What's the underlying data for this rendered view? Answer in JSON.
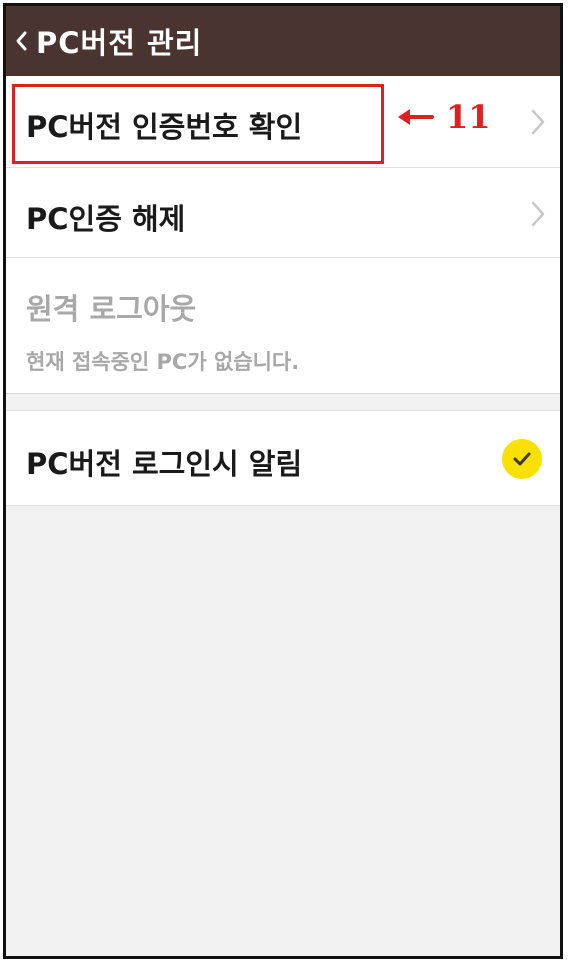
{
  "header": {
    "title": "PC버전 관리"
  },
  "menu": {
    "items": [
      {
        "label": "PC버전 인증번호 확인"
      },
      {
        "label": "PC인증 해제"
      },
      {
        "label": "원격 로그아웃",
        "sub": "현재 접속중인 PC가 없습니다."
      },
      {
        "label": "PC버전 로그인시 알림",
        "checked": true
      }
    ]
  },
  "annotation": {
    "number": "11",
    "color": "#e02020"
  },
  "colors": {
    "header_bg": "#4a3430",
    "toggle_on": "#f9e000",
    "disabled_text": "#a8a8a8"
  },
  "icons": {
    "back": "chevron-left-icon",
    "row_arrow": "chevron-right-icon",
    "check": "check-icon",
    "annotation_arrow": "arrow-left-icon"
  }
}
